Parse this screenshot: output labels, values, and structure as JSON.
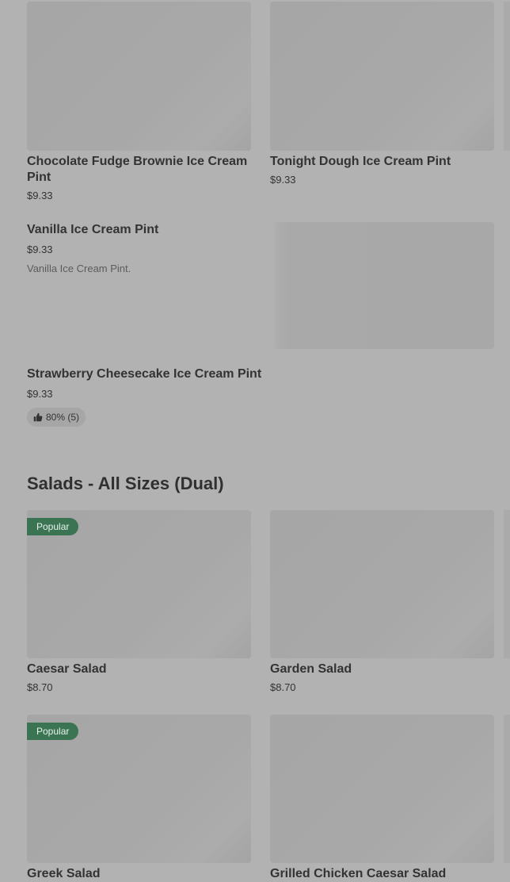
{
  "ice_cream": {
    "grid_items": [
      {
        "name": "Chocolate Fudge Brownie Ice Cream Pint",
        "price": "$9.33"
      },
      {
        "name": "Tonight Dough Ice Cream Pint",
        "price": "$9.33"
      }
    ],
    "list_items": [
      {
        "name": "Vanilla Ice Cream Pint",
        "price": "$9.33",
        "description": "Vanilla Ice Cream Pint."
      },
      {
        "name": "Strawberry Cheesecake Ice Cream Pint",
        "price": "$9.33",
        "rating": "80% (5)"
      }
    ]
  },
  "salads": {
    "title": "Salads - All Sizes (Dual)",
    "items": [
      {
        "name": "Caesar Salad",
        "price": "$8.70",
        "badge": "Popular"
      },
      {
        "name": "Garden Salad",
        "price": "$8.70"
      },
      {
        "name": "Greek Salad",
        "badge": "Popular"
      },
      {
        "name": "Grilled Chicken Caesar Salad"
      }
    ]
  },
  "icons": {
    "thumbs_up": "thumbs-up-icon"
  },
  "colors": {
    "background": "#b2b2b2",
    "badge": "#3a7453",
    "text": "#333333"
  }
}
